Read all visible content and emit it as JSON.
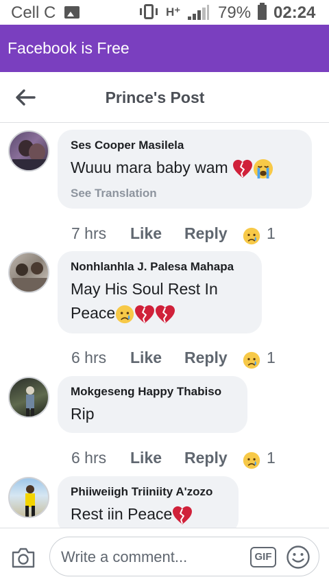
{
  "status_bar": {
    "carrier": "Cell C",
    "network": "H⁺",
    "battery": "79%",
    "time": "02:24"
  },
  "app_banner": {
    "title": "Facebook is Free"
  },
  "header": {
    "title": "Prince's Post"
  },
  "actions_labels": {
    "like": "Like",
    "reply": "Reply"
  },
  "comments": [
    {
      "author": "Ses Cooper Masilela",
      "text": "Wuuu mara baby wam",
      "see_translation": "See Translation",
      "time": "7 hrs",
      "reaction_count": "1",
      "reaction": "sad-emoji"
    },
    {
      "author": "Nonhlanhla J. Palesa Mahapa",
      "text_line1": "May His Soul Rest In",
      "text_line2": "Peace",
      "time": "6 hrs",
      "reaction_count": "1",
      "reaction": "sad-emoji"
    },
    {
      "author": "Mokgeseng Happy Thabiso",
      "text": "Rip",
      "time": "6 hrs",
      "reaction_count": "1",
      "reaction": "sad-emoji"
    },
    {
      "author": "Phiiweiigh Triiniity A'zozo",
      "text": "Rest iin Peace"
    }
  ],
  "composer": {
    "placeholder": "Write a comment...",
    "gif_label": "GIF"
  },
  "colors": {
    "banner": "#7a3fbf",
    "bubble": "#f0f2f5",
    "secondary_text": "#606770"
  }
}
